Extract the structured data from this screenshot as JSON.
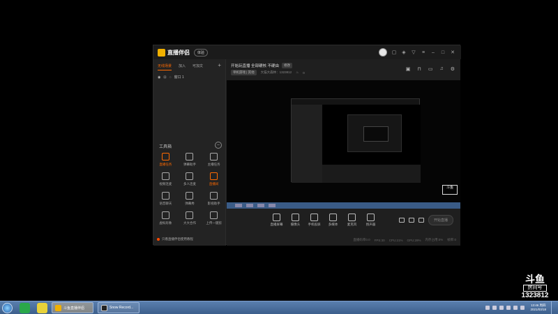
{
  "app": {
    "title": "直播伴侣",
    "badge": "体验",
    "window_controls": [
      "avatar",
      "message-icon",
      "skin-icon",
      "gift-icon",
      "menu-icon",
      "minimize-icon",
      "maximize-icon",
      "close-icon"
    ]
  },
  "left": {
    "tabs": [
      {
        "label": "无线场景",
        "active": true
      },
      {
        "label": "加入",
        "active": false
      },
      {
        "label": "可加文",
        "active": false
      }
    ],
    "add_label": "+",
    "source": {
      "label": "窗口 1"
    },
    "tools_title": "工具箱",
    "tools": [
      {
        "label": "直播任务",
        "hot": true
      },
      {
        "label": "弹幕助手",
        "hot": false
      },
      {
        "label": "主播任务",
        "hot": false
      },
      {
        "label": "视频连麦",
        "hot": false
      },
      {
        "label": "多人连麦",
        "hot": false
      },
      {
        "label": "直播间",
        "hot": true
      },
      {
        "label": "语音聊天",
        "hot": false
      },
      {
        "label": "弹幕秀",
        "hot": false
      },
      {
        "label": "影视助手",
        "hot": false
      },
      {
        "label": "虚拟形象",
        "hot": false
      },
      {
        "label": "大大合作",
        "hot": false
      },
      {
        "label": "上传一键剪",
        "hot": false
      }
    ],
    "tip": "只看直播伴侣使用教程"
  },
  "room": {
    "title": "开始玩直播 全部硬核 不硬由",
    "edit_label": "修改",
    "category": "单机游戏 | 其他",
    "id_label": "大猫大森林：1323812",
    "fans": "0"
  },
  "dock": {
    "buttons": [
      {
        "label": "直播屏幕",
        "icon": "screen-icon"
      },
      {
        "label": "摄像头",
        "icon": "camera-icon"
      },
      {
        "label": "手机投屏",
        "icon": "phone-icon"
      },
      {
        "label": "多媒体",
        "icon": "media-icon"
      },
      {
        "label": "麦克风",
        "icon": "microphone-icon"
      },
      {
        "label": "扬声器",
        "icon": "speaker-icon"
      }
    ],
    "start_label": "开始直播"
  },
  "status": [
    "直播码率0.0",
    "FPS:30",
    "CPU:21%",
    "GPU:29%",
    "内存占用:0%",
    "帧率:0"
  ],
  "douyu": {
    "logo": "斗鱼",
    "sub": "房间号",
    "room": "1323812"
  },
  "taskbar": {
    "tasks": [
      {
        "label": "斗鱼直播伴侣"
      },
      {
        "label": "Snow Record..."
      }
    ],
    "clock_time": "13:46 周四",
    "clock_date": "2021/03/18"
  }
}
